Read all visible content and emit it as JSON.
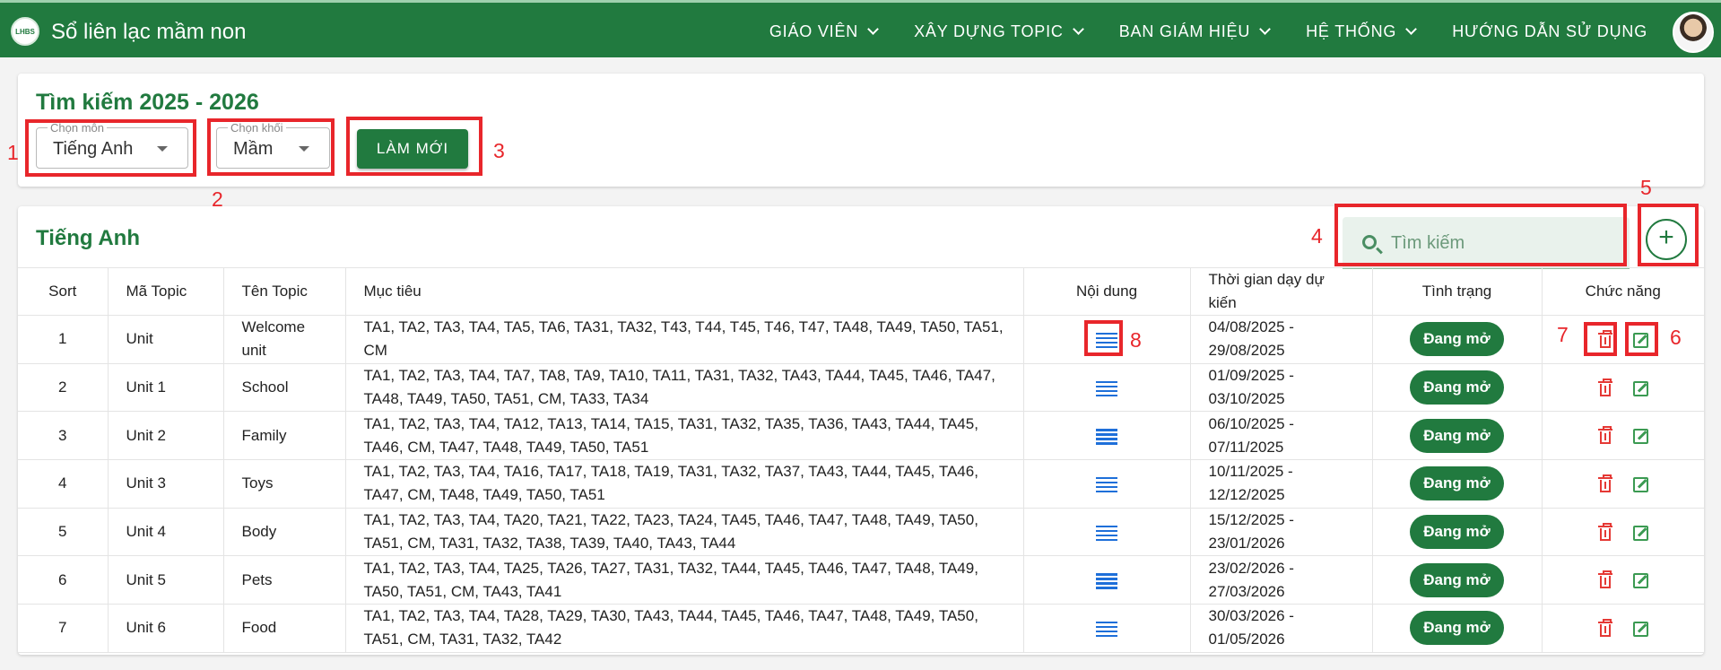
{
  "app": {
    "logo_text": "LHBS",
    "title": "Sổ liên lạc mầm non"
  },
  "nav": [
    {
      "label": "GIÁO VIÊN"
    },
    {
      "label": "XÂY DỰNG TOPIC"
    },
    {
      "label": "BAN GIÁM HIỆU"
    },
    {
      "label": "HỆ THỐNG"
    },
    {
      "label": "HƯỚNG DẪN SỬ DỤNG"
    }
  ],
  "search_panel": {
    "title": "Tìm kiếm  2025 - 2026",
    "subject": {
      "legend": "Chọn môn",
      "value": "Tiếng Anh"
    },
    "grade": {
      "legend": "Chọn khối",
      "value": "Mầm"
    },
    "reset_label": "LÀM MỚI"
  },
  "list_panel": {
    "title": "Tiếng Anh",
    "search_placeholder": "Tìm kiếm",
    "add_label": "+"
  },
  "table": {
    "headers": {
      "sort": "Sort",
      "ma": "Mã Topic",
      "ten": "Tên Topic",
      "muc": "Mục tiêu",
      "noi": "Nội dung",
      "tg": "Thời gian dạy dự kiến",
      "tt": "Tình trạng",
      "cn": "Chức năng"
    },
    "rows": [
      {
        "sort": "1",
        "ma": "Unit",
        "ten": "Welcome unit",
        "muc": "TA1, TA2, TA3, TA4, TA5, TA6, TA31, TA32, T43, T44, T45, T46, T47, TA48, TA49, TA50, TA51, CM",
        "tg": "04/08/2025 - 29/08/2025",
        "status": "Đang mở"
      },
      {
        "sort": "2",
        "ma": "Unit 1",
        "ten": "School",
        "muc": "TA1, TA2, TA3, TA4, TA7, TA8, TA9, TA10, TA11, TA31, TA32, TA43, TA44, TA45, TA46, TA47, TA48, TA49, TA50, TA51, CM, TA33, TA34",
        "tg": "01/09/2025 - 03/10/2025",
        "status": "Đang mở"
      },
      {
        "sort": "3",
        "ma": "Unit 2",
        "ten": "Family",
        "muc": "TA1, TA2, TA3, TA4, TA12, TA13, TA14, TA15, TA31, TA32, TA35, TA36, TA43, TA44, TA45, TA46, CM, TA47, TA48, TA49, TA50, TA51",
        "tg": "06/10/2025 - 07/11/2025",
        "status": "Đang mở"
      },
      {
        "sort": "4",
        "ma": "Unit 3",
        "ten": "Toys",
        "muc": "TA1, TA2, TA3, TA4, TA16, TA17, TA18, TA19, TA31, TA32, TA37, TA43, TA44, TA45, TA46, TA47, CM, TA48, TA49, TA50, TA51",
        "tg": "10/11/2025 - 12/12/2025",
        "status": "Đang mở"
      },
      {
        "sort": "5",
        "ma": "Unit 4",
        "ten": "Body",
        "muc": "TA1, TA2, TA3, TA4, TA20, TA21, TA22, TA23, TA24, TA45, TA46, TA47, TA48, TA49, TA50, TA51, CM, TA31, TA32, TA38, TA39, TA40, TA43, TA44",
        "tg": "15/12/2025 - 23/01/2026",
        "status": "Đang mở"
      },
      {
        "sort": "6",
        "ma": "Unit 5",
        "ten": "Pets",
        "muc": "TA1, TA2, TA3, TA4, TA25, TA26, TA27, TA31, TA32, TA44, TA45, TA46, TA47, TA48, TA49, TA50, TA51, CM, TA43, TA41",
        "tg": "23/02/2026 - 27/03/2026",
        "status": "Đang mở"
      },
      {
        "sort": "7",
        "ma": "Unit 6",
        "ten": "Food",
        "muc": "TA1, TA2, TA3, TA4, TA28, TA29, TA30, TA43, TA44, TA45, TA46, TA47, TA48, TA49, TA50, TA51, CM, TA31, TA32, TA42",
        "tg": "30/03/2026 - 01/05/2026",
        "status": "Đang mở"
      }
    ]
  },
  "annotations": [
    "1",
    "2",
    "3",
    "4",
    "5",
    "6",
    "7",
    "8"
  ],
  "colors": {
    "brand": "#217a3f",
    "delete": "#e53935",
    "edit": "#3b9a52",
    "content_icon": "#1e6fd9",
    "annotation": "#e8262b"
  }
}
